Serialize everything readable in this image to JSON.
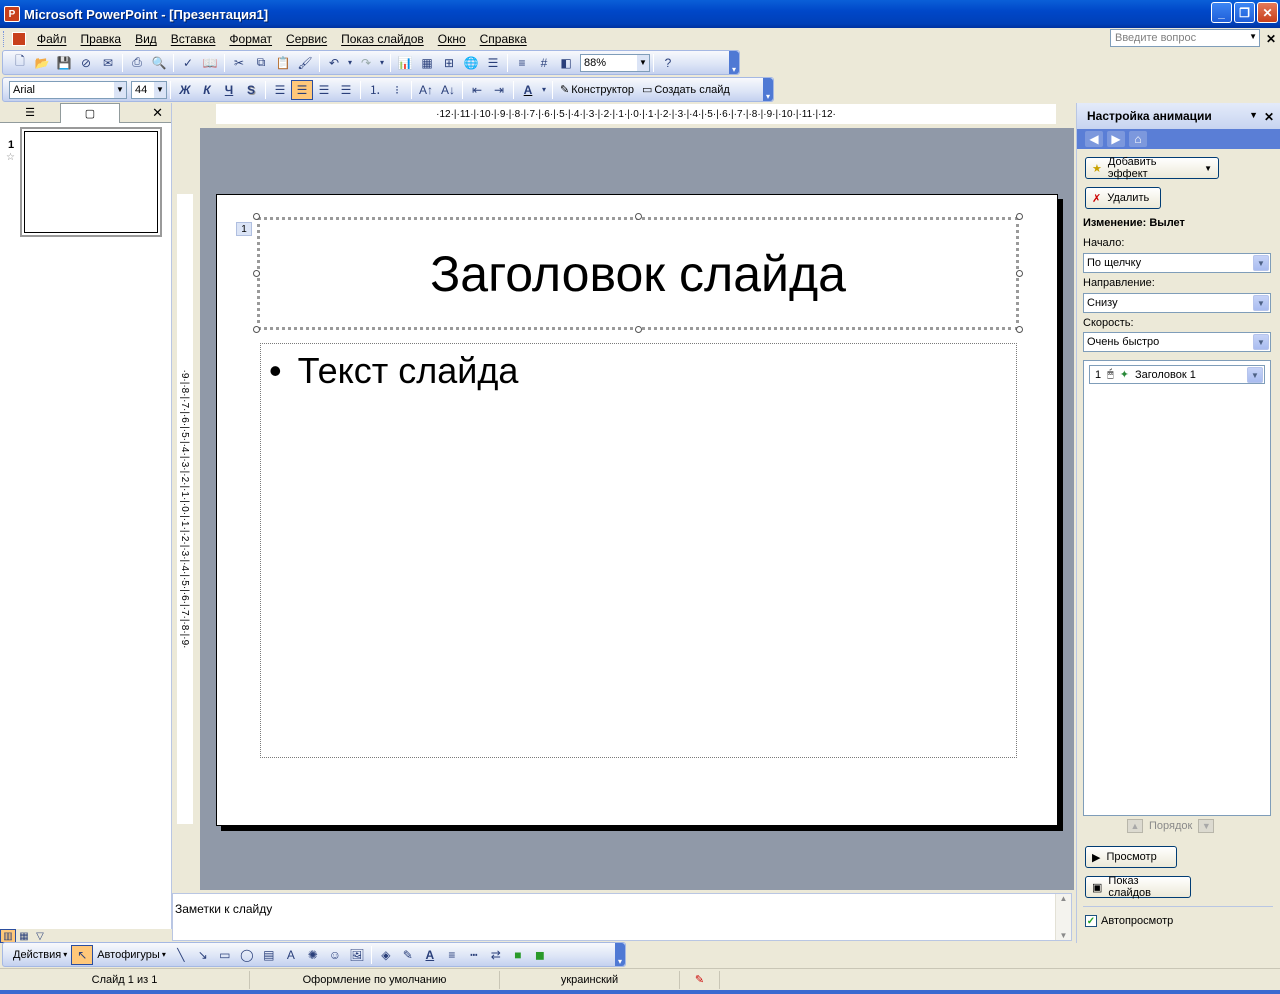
{
  "window": {
    "title": "Microsoft PowerPoint - [Презентация1]"
  },
  "menu": {
    "items": [
      "Файл",
      "Правка",
      "Вид",
      "Вставка",
      "Формат",
      "Сервис",
      "Показ слайдов",
      "Окно",
      "Справка"
    ],
    "question_placeholder": "Введите вопрос"
  },
  "toolbar1": {
    "zoom": "88%"
  },
  "toolbar2": {
    "font": "Arial",
    "size": "44",
    "bold": "Ж",
    "italic": "К",
    "underline": "Ч",
    "shadow": "S",
    "designer": "Конструктор",
    "new_slide": "Создать слайд"
  },
  "outline": {
    "slide_number": "1"
  },
  "rulers": {
    "horizontal": "·12·|·11·|·10·|·9·|·8·|·7·|·6·|·5·|·4·|·3·|·2·|·1·|·0·|·1·|·2·|·3·|·4·|·5·|·6·|·7·|·8·|·9·|·10·|·11·|·12·",
    "vertical": "·9·|·8·|·7·|·6·|·5·|·4·|·3·|·2·|·1·|·0·|·1·|·2·|·3·|·4·|·5·|·6·|·7·|·8·|·9·"
  },
  "slide": {
    "title": "Заголовок слайда",
    "bullet": "•",
    "body": "Текст слайда",
    "anim_tag": "1"
  },
  "notes": {
    "placeholder": "Заметки к слайду"
  },
  "taskpane": {
    "title": "Настройка анимации",
    "add_effect": "Добавить эффект",
    "remove": "Удалить",
    "change_label": "Изменение: Вылет",
    "start_label": "Начало:",
    "start_value": "По щелчку",
    "direction_label": "Направление:",
    "direction_value": "Снизу",
    "speed_label": "Скорость:",
    "speed_value": "Очень быстро",
    "anim_item_num": "1",
    "anim_item_name": "Заголовок 1",
    "order_label": "Порядок",
    "preview": "Просмотр",
    "slideshow": "Показ слайдов",
    "autopreview": "Автопросмотр",
    "autopreview_checked": true
  },
  "drawbar": {
    "actions": "Действия",
    "autoshapes": "Автофигуры"
  },
  "status": {
    "slide": "Слайд 1 из 1",
    "design": "Оформление по умолчанию",
    "language": "украинский"
  }
}
